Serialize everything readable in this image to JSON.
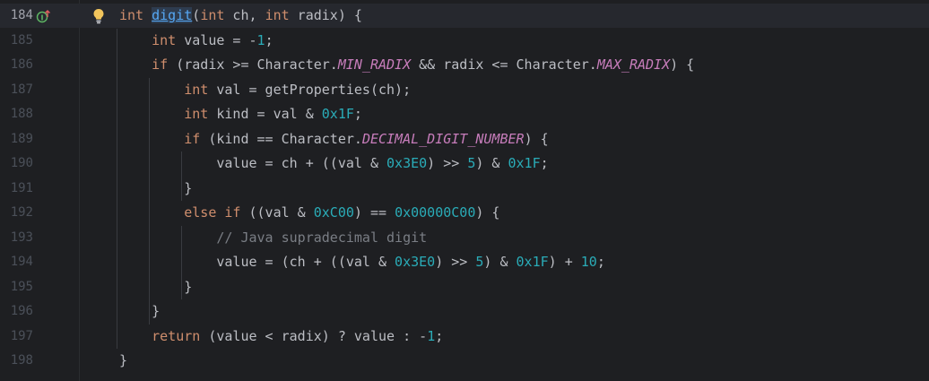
{
  "gutter": {
    "line_numbers": [
      "184",
      "185",
      "186",
      "187",
      "188",
      "189",
      "190",
      "191",
      "192",
      "193",
      "194",
      "195",
      "196",
      "197",
      "198"
    ],
    "current_line": "184",
    "marker_icon": "implementation-override-icon",
    "bulb_icon": "lightbulb-intention-icon"
  },
  "colors": {
    "background": "#1e1f22",
    "keyword": "#cf8e6d",
    "number": "#2aacb8",
    "constant": "#c77dbb",
    "comment": "#7a7e85",
    "method": "#56a8f5",
    "text": "#bcbec4"
  },
  "lines": [
    [
      {
        "t": "kw",
        "v": "int"
      },
      {
        "t": "txt",
        "v": " "
      },
      {
        "t": "decl",
        "v": "digit"
      },
      {
        "t": "txt",
        "v": "("
      },
      {
        "t": "kw",
        "v": "int"
      },
      {
        "t": "txt",
        "v": " ch, "
      },
      {
        "t": "kw",
        "v": "int"
      },
      {
        "t": "txt",
        "v": " radix) {"
      }
    ],
    [
      {
        "t": "txt",
        "v": "    "
      },
      {
        "t": "kw",
        "v": "int"
      },
      {
        "t": "txt",
        "v": " value = -"
      },
      {
        "t": "num",
        "v": "1"
      },
      {
        "t": "txt",
        "v": ";"
      }
    ],
    [
      {
        "t": "txt",
        "v": "    "
      },
      {
        "t": "kw",
        "v": "if"
      },
      {
        "t": "txt",
        "v": " (radix >= Character."
      },
      {
        "t": "const",
        "v": "MIN_RADIX"
      },
      {
        "t": "txt",
        "v": " && radix <= Character."
      },
      {
        "t": "const",
        "v": "MAX_RADIX"
      },
      {
        "t": "txt",
        "v": ") {"
      }
    ],
    [
      {
        "t": "txt",
        "v": "        "
      },
      {
        "t": "kw",
        "v": "int"
      },
      {
        "t": "txt",
        "v": " val = getProperties(ch);"
      }
    ],
    [
      {
        "t": "txt",
        "v": "        "
      },
      {
        "t": "kw",
        "v": "int"
      },
      {
        "t": "txt",
        "v": " kind = val & "
      },
      {
        "t": "num",
        "v": "0x1F"
      },
      {
        "t": "txt",
        "v": ";"
      }
    ],
    [
      {
        "t": "txt",
        "v": "        "
      },
      {
        "t": "kw",
        "v": "if"
      },
      {
        "t": "txt",
        "v": " (kind == Character."
      },
      {
        "t": "const",
        "v": "DECIMAL_DIGIT_NUMBER"
      },
      {
        "t": "txt",
        "v": ") {"
      }
    ],
    [
      {
        "t": "txt",
        "v": "            value = ch + ((val & "
      },
      {
        "t": "num",
        "v": "0x3E0"
      },
      {
        "t": "txt",
        "v": ") >> "
      },
      {
        "t": "num",
        "v": "5"
      },
      {
        "t": "txt",
        "v": ") & "
      },
      {
        "t": "num",
        "v": "0x1F"
      },
      {
        "t": "txt",
        "v": ";"
      }
    ],
    [
      {
        "t": "txt",
        "v": "        }"
      }
    ],
    [
      {
        "t": "txt",
        "v": "        "
      },
      {
        "t": "kw",
        "v": "else if"
      },
      {
        "t": "txt",
        "v": " ((val & "
      },
      {
        "t": "num",
        "v": "0xC00"
      },
      {
        "t": "txt",
        "v": ") == "
      },
      {
        "t": "num",
        "v": "0x00000C00"
      },
      {
        "t": "txt",
        "v": ") {"
      }
    ],
    [
      {
        "t": "txt",
        "v": "            "
      },
      {
        "t": "cmt",
        "v": "// Java supradecimal digit"
      }
    ],
    [
      {
        "t": "txt",
        "v": "            value = (ch + ((val & "
      },
      {
        "t": "num",
        "v": "0x3E0"
      },
      {
        "t": "txt",
        "v": ") >> "
      },
      {
        "t": "num",
        "v": "5"
      },
      {
        "t": "txt",
        "v": ") & "
      },
      {
        "t": "num",
        "v": "0x1F"
      },
      {
        "t": "txt",
        "v": ") + "
      },
      {
        "t": "num",
        "v": "10"
      },
      {
        "t": "txt",
        "v": ";"
      }
    ],
    [
      {
        "t": "txt",
        "v": "        }"
      }
    ],
    [
      {
        "t": "txt",
        "v": "    }"
      }
    ],
    [
      {
        "t": "txt",
        "v": "    "
      },
      {
        "t": "kw",
        "v": "return"
      },
      {
        "t": "txt",
        "v": " (value < radix) ? value : -"
      },
      {
        "t": "num",
        "v": "1"
      },
      {
        "t": "txt",
        "v": ";"
      }
    ],
    [
      {
        "t": "txt",
        "v": "}"
      }
    ]
  ]
}
